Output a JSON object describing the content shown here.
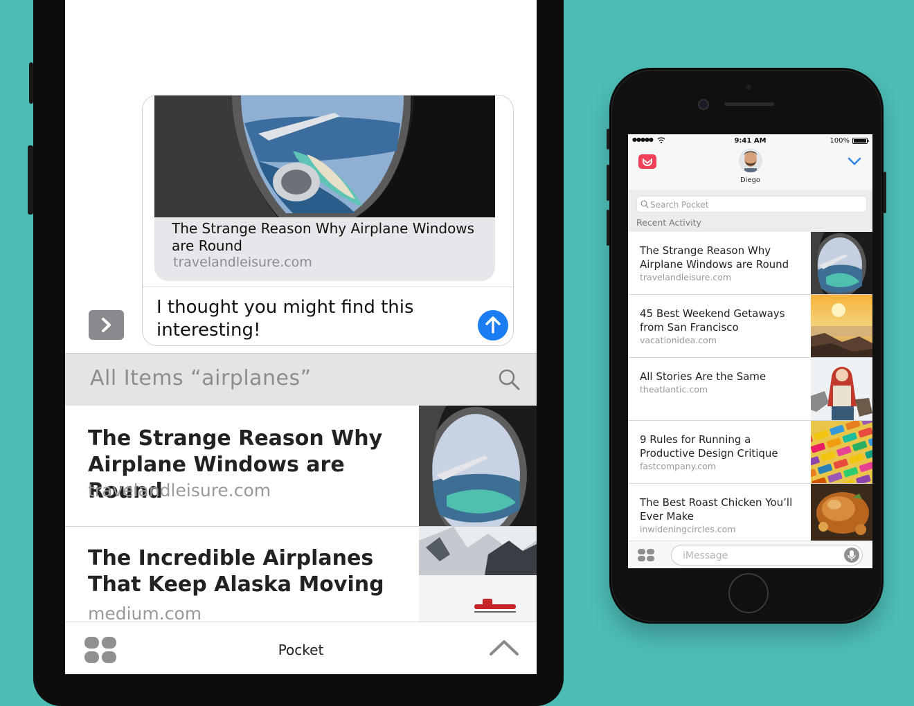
{
  "zoomed": {
    "card": {
      "title": "The Strange Reason Why Airplane Windows are Round",
      "source": "travelandleisure.com",
      "message": "I thought you might find this interesting!"
    },
    "filter_label": "All Items “airplanes”",
    "rows": [
      {
        "title": "The Strange Reason Why Airplane Windows are Round",
        "source": "travelandleisure.com"
      },
      {
        "title": "The Incredible Airplanes That Keep Alaska Moving",
        "source": "medium.com"
      }
    ],
    "bottom_title": "Pocket"
  },
  "phone": {
    "status": {
      "time": "9:41 AM",
      "battery": "100%"
    },
    "contact_name": "Diego",
    "search_placeholder": "Search Pocket",
    "section_label": "Recent Activity",
    "items": [
      {
        "title": "The Strange Reason Why Airplane Windows are Round",
        "source": "travelandleisure.com"
      },
      {
        "title": "45 Best Weekend Getaways from San Francisco",
        "source": "vacationidea.com"
      },
      {
        "title": "All Stories Are the Same",
        "source": "theatlantic.com"
      },
      {
        "title": "9 Rules for Running a Productive Design Critique",
        "source": "fastcompany.com"
      },
      {
        "title": "The Best Roast Chicken You’ll Ever Make",
        "source": "inwideningcircles.com"
      }
    ],
    "imessage_placeholder": "iMessage"
  },
  "colors": {
    "background": "#4dbdb6",
    "pocket": "#ee4056",
    "send": "#1a7ef2",
    "chevron": "#2b82e8"
  }
}
